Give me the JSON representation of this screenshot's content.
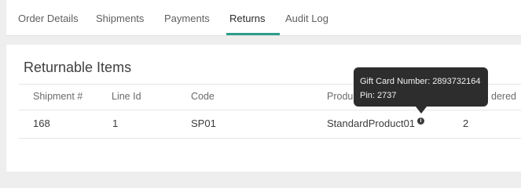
{
  "tabs": [
    {
      "label": "Order Details",
      "active": false
    },
    {
      "label": "Shipments",
      "active": false
    },
    {
      "label": "Payments",
      "active": false
    },
    {
      "label": "Returns",
      "active": true
    },
    {
      "label": "Audit Log",
      "active": false
    }
  ],
  "accent_color": "#2e9d8a",
  "section_title": "Returnable Items",
  "table": {
    "headers": [
      "Shipment #",
      "Line Id",
      "Code",
      "Produ",
      "dered"
    ],
    "rows": [
      {
        "shipment": "168",
        "line_id": "1",
        "code": "SP01",
        "product": "StandardProduct01",
        "ordered": "2"
      }
    ]
  },
  "tooltip": {
    "line1": "Gift Card Number: 2893732164",
    "line2": "Pin: 2737"
  },
  "info_icon": "info-icon"
}
